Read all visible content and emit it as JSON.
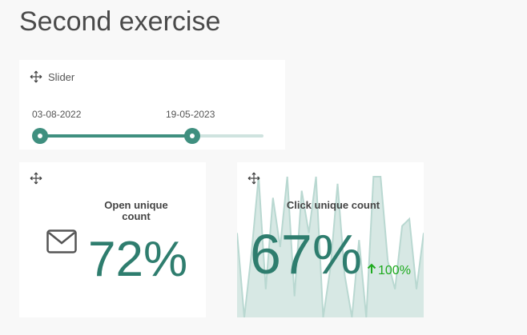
{
  "page": {
    "title": "Second exercise"
  },
  "slider": {
    "title": "Slider",
    "start_label": "03-08-2022",
    "end_label": "19-05-2023",
    "range_start_fraction": 0.0,
    "range_end_fraction": 0.68,
    "color_track": "#cfe3df",
    "color_fill": "#3f8f7f"
  },
  "open_kpi": {
    "label": "Open unique count",
    "value": "72%",
    "icon": "envelope-icon",
    "color": "#2e7d6e"
  },
  "click_kpi": {
    "label": "Click unique count",
    "value": "67%",
    "delta": "100%",
    "delta_icon": "arrow-up-icon",
    "delta_color": "#1eaa1e",
    "sparkline": [
      60,
      0,
      45,
      100,
      20,
      85,
      50,
      100,
      15,
      90,
      60,
      100,
      0,
      35,
      95,
      30,
      0,
      55,
      0,
      100,
      100,
      40,
      20,
      65,
      70,
      20,
      60
    ],
    "spark_fill": "#d7e8e4",
    "spark_line": "#b9d8d1"
  },
  "icons": {
    "move": "move-icon"
  }
}
